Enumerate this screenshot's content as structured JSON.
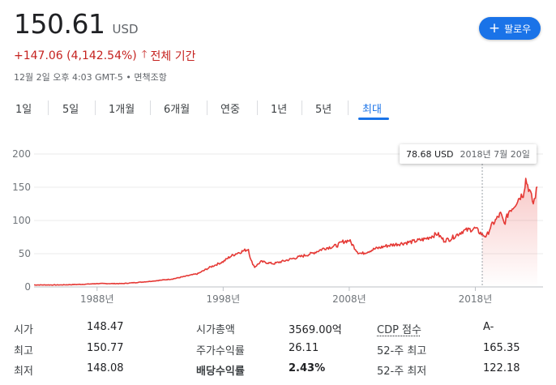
{
  "quote": {
    "price": "150.61",
    "currency": "USD",
    "change": "+147.06 (4,142.54%)",
    "period": "전체 기간",
    "timestamp": "12월 2일 오후 4:03 GMT-5 • 면책조항"
  },
  "follow_button": {
    "label": "팔로우"
  },
  "tabs": [
    "1일",
    "5일",
    "1개월",
    "6개월",
    "연중",
    "1년",
    "5년",
    "최대"
  ],
  "active_tab": "최대",
  "tooltip": {
    "value": "78.68 USD",
    "date": "2018년 7월 20일"
  },
  "colors": {
    "line": "#e53935",
    "accent": "#1a73e8",
    "negative": "#c5221f"
  },
  "chart_data": {
    "type": "line",
    "x": [
      1983,
      1985,
      1987,
      1988,
      1990,
      1992,
      1994,
      1995,
      1996,
      1997,
      1998,
      1998.5,
      1999,
      2000,
      2000.2,
      2000.5,
      2001,
      2002,
      2003,
      2004,
      2005,
      2006,
      2007,
      2007.5,
      2008,
      2008.7,
      2009,
      2010,
      2011,
      2012,
      2013,
      2014,
      2015,
      2015.5,
      2016,
      2017,
      2018,
      2018.55,
      2018.9,
      2019.2,
      2019.6,
      2020,
      2020.3,
      2020.7,
      2021,
      2021.5,
      2021.8,
      2022,
      2022.3,
      2022.6,
      2022.92
    ],
    "y": [
      3,
      3,
      4,
      5,
      5,
      8,
      12,
      16,
      20,
      30,
      38,
      45,
      50,
      57,
      40,
      30,
      38,
      35,
      40,
      45,
      50,
      58,
      62,
      68,
      70,
      52,
      50,
      57,
      62,
      65,
      68,
      72,
      80,
      70,
      72,
      84,
      88,
      78.68,
      76,
      90,
      100,
      110,
      95,
      115,
      120,
      135,
      140,
      162,
      145,
      125,
      150.61
    ],
    "xticks": [
      "1988년",
      "1998년",
      "2008년",
      "2018년"
    ],
    "ytick_labels": [
      "0",
      "50",
      "100",
      "150",
      "200"
    ],
    "ylim": [
      0,
      200
    ],
    "grid": true,
    "title": "",
    "xlabel": "",
    "ylabel": ""
  },
  "stats": [
    [
      {
        "label": "시가",
        "value": "148.47"
      },
      {
        "label": "시가총액",
        "value": "3569.00억"
      },
      {
        "label": "CDP 점수",
        "value": "A-"
      }
    ],
    [
      {
        "label": "최고",
        "value": "150.77"
      },
      {
        "label": "주가수익률",
        "value": "26.11"
      },
      {
        "label": "52-주 최고",
        "value": "165.35"
      }
    ],
    [
      {
        "label": "최저",
        "value": "148.08"
      },
      {
        "label": "배당수익률",
        "value": "2.43%"
      },
      {
        "label": "52-주 최저",
        "value": "122.18"
      }
    ]
  ]
}
